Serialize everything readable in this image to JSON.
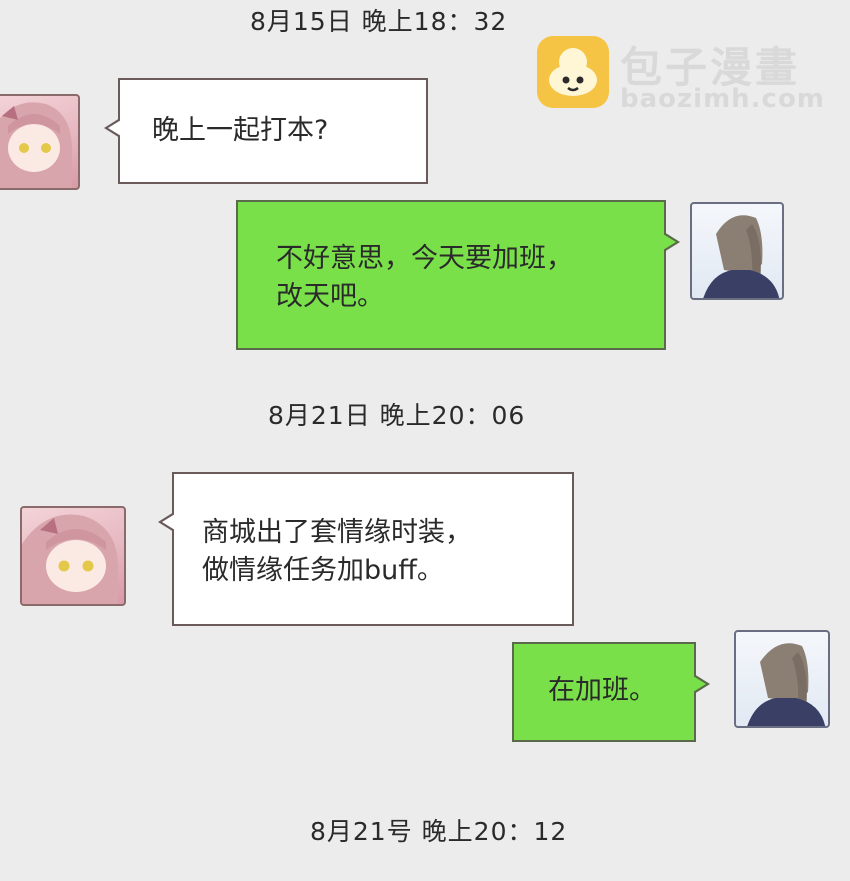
{
  "watermark": {
    "title": "包子漫畫",
    "url": "baozimh.com"
  },
  "chat": {
    "timestamps": [
      "8月15日 晚上18：32",
      "8月21日 晚上20：06",
      "8月21号 晚上20：12"
    ],
    "messages": [
      {
        "lines": [
          "晚上一起打本?"
        ]
      },
      {
        "lines": [
          "不好意思，今天要加班，",
          "改天吧。"
        ]
      },
      {
        "lines": [
          "商城出了套情缘时装，",
          "做情缘任务加buff。"
        ]
      },
      {
        "lines": [
          "在加班。"
        ]
      }
    ]
  },
  "colors": {
    "background": "#ececec",
    "incoming_bubble": "#ffffff",
    "outgoing_bubble": "#79e04a",
    "watermark_logo": "#f6c445"
  }
}
